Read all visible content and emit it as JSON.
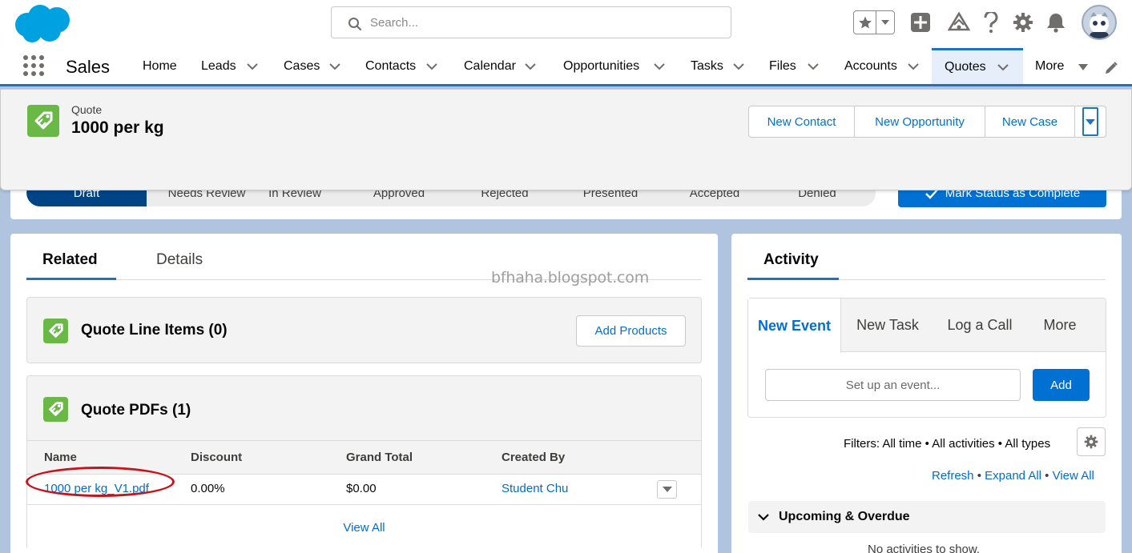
{
  "header": {
    "search_placeholder": "Search...",
    "icons": [
      "salesforce-logo",
      "search-icon",
      "star-icon",
      "chevron-down-icon",
      "plus-icon",
      "trailhead-icon",
      "help-icon",
      "gear-icon",
      "bell-icon",
      "avatar"
    ]
  },
  "nav": {
    "app_name": "Sales",
    "items": [
      {
        "label": "Home"
      },
      {
        "label": "Leads"
      },
      {
        "label": "Cases"
      },
      {
        "label": "Contacts"
      },
      {
        "label": "Calendar"
      },
      {
        "label": "Opportunities"
      },
      {
        "label": "Tasks"
      },
      {
        "label": "Files"
      },
      {
        "label": "Accounts"
      },
      {
        "label": "Quotes",
        "active": true
      },
      {
        "label": "More"
      }
    ]
  },
  "record": {
    "object_label": "Quote",
    "title": "1000 per kg",
    "actions": [
      "New Contact",
      "New Opportunity",
      "New Case"
    ]
  },
  "path": {
    "stages": [
      "Draft",
      "Needs Review",
      "In Review",
      "Approved",
      "Rejected",
      "Presented",
      "Accepted",
      "Denied"
    ],
    "current": "Draft",
    "mark_button": "Mark Status as Complete"
  },
  "related": {
    "tabs": [
      "Related",
      "Details"
    ],
    "active_tab": "Related",
    "watermark": "bfhaha.blogspot.com",
    "line_items": {
      "title": "Quote Line Items (0)",
      "button": "Add Products"
    },
    "pdfs": {
      "title": "Quote PDFs (1)",
      "columns": [
        "Name",
        "Discount",
        "Grand Total",
        "Created By"
      ],
      "rows": [
        {
          "name": "1000 per kg_V1.pdf",
          "discount": "0.00%",
          "grand_total": "$0.00",
          "created_by": "Student Chu"
        }
      ],
      "view_all": "View All"
    }
  },
  "activity": {
    "tab": "Activity",
    "composer_tabs": [
      "New Event",
      "New Task",
      "Log a Call",
      "More"
    ],
    "active_composer_tab": "New Event",
    "input_placeholder": "Set up an event...",
    "add_button": "Add",
    "filters": "Filters: All time • All activities • All types",
    "links": [
      "Refresh",
      "Expand All",
      "View All"
    ],
    "upcoming": "Upcoming & Overdue",
    "empty_text": "No activities to show."
  },
  "colors": {
    "brand_blue": "#0070d2",
    "path_current": "#014486",
    "quote_green": "#6ab845",
    "annotation_red": "#c8131b",
    "background": "#b0c4df"
  }
}
